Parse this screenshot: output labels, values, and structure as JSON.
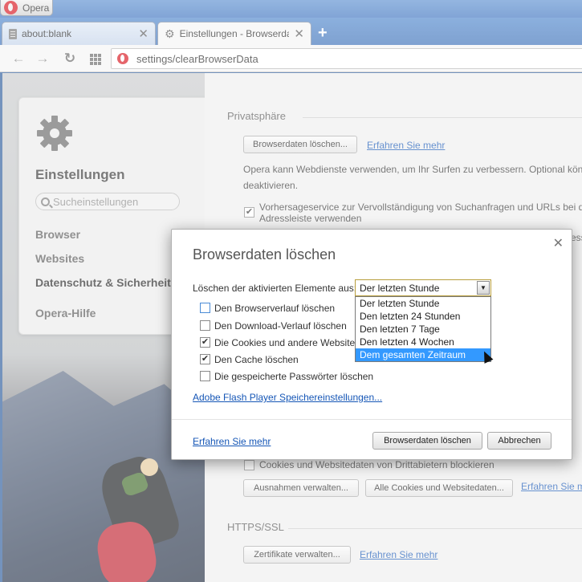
{
  "window": {
    "app_name": "Opera"
  },
  "tabs": [
    {
      "title": "about:blank"
    },
    {
      "title": "Einstellungen - Browserdaten"
    }
  ],
  "toolbar": {
    "address": "settings/clearBrowserData"
  },
  "sidebar": {
    "title": "Einstellungen",
    "search_placeholder": "Sucheinstellungen",
    "items": [
      {
        "label": "Browser"
      },
      {
        "label": "Websites"
      },
      {
        "label": "Datenschutz & Sicherheit"
      },
      {
        "label": "Opera-Hilfe"
      }
    ]
  },
  "main": {
    "privacy_heading": "Privatsphäre",
    "clear_button": "Browserdaten löschen...",
    "learn_more": "Erfahren Sie mehr",
    "intro_line1": "Opera kann Webdienste verwenden, um Ihr Surfen zu verbessern. Optional können Sie diese deaktivieren.",
    "intro_line2": "deaktivieren.",
    "predict_line1": "Vorhersageservice zur Vervollständigung von Suchanfragen und URLs bei der Eingabe in die",
    "predict_line2": "Adressleiste verwenden",
    "third_party_cookies": "Cookies und Websitedaten von Drittabietern blockieren",
    "manage_exceptions": "Ausnahmen verwalten...",
    "all_cookies": "Alle Cookies und Websitedaten...",
    "learn_more_2": "Erfahren Sie mehr",
    "https_heading": "HTTPS/SSL",
    "manage_certs": "Zertifikate verwalten...",
    "learn_more_3": "Erfahren Sie mehr",
    "edge_fragment": "ess"
  },
  "dialog": {
    "title": "Browserdaten löschen",
    "period_label": "Löschen der aktivierten Elemente aus:",
    "period_selected": "Der letzten Stunde",
    "period_options": [
      {
        "label": "Der letzten Stunde",
        "selected": false
      },
      {
        "label": "Den letzten 24 Stunden",
        "selected": false
      },
      {
        "label": "Den letzten 7 Tage",
        "selected": false
      },
      {
        "label": "Den letzten 4 Wochen",
        "selected": false
      },
      {
        "label": "Dem gesamten Zeitraum",
        "selected": true
      }
    ],
    "checkboxes": [
      {
        "label": "Den Browserverlauf löschen",
        "checked": false
      },
      {
        "label": "Den Download-Verlauf löschen",
        "checked": false
      },
      {
        "label": "Die Cookies und andere Websitedaten löschen",
        "checked": true
      },
      {
        "label": "Den Cache löschen",
        "checked": true
      },
      {
        "label": "Die gespeicherte Passwörter löschen",
        "checked": false
      }
    ],
    "flash_link": "Adobe Flash Player Speichereinstellungen...",
    "learn_more": "Erfahren Sie mehr",
    "confirm_button": "Browserdaten löschen",
    "cancel_button": "Abbrechen"
  },
  "colors": {
    "accent_link": "#1556b6",
    "selection": "#3399ff",
    "opera_red": "#d8131c"
  },
  "icons": {
    "close": "close-icon",
    "gear": "gear-icon",
    "checkmark": "✔"
  }
}
